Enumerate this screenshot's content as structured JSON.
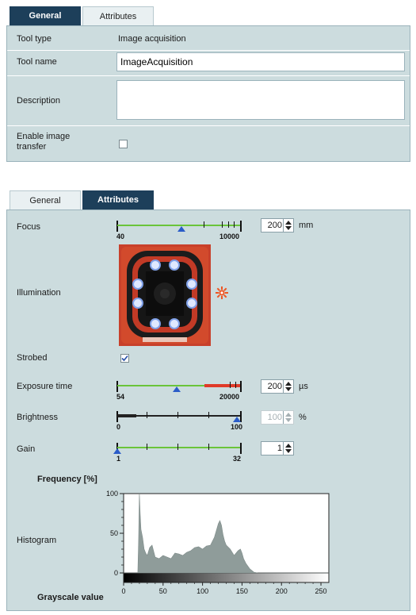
{
  "top_panel": {
    "tabs": [
      {
        "label": "General",
        "active": true
      },
      {
        "label": "Attributes",
        "active": false
      }
    ],
    "tool_type": {
      "label": "Tool type",
      "value": "Image acquisition"
    },
    "tool_name": {
      "label": "Tool name",
      "value": "ImageAcquisition"
    },
    "description": {
      "label": "Description",
      "value": ""
    },
    "enable_transfer": {
      "label": "Enable image transfer",
      "checked": false
    }
  },
  "bottom_panel": {
    "tabs": [
      {
        "label": "General",
        "active": false
      },
      {
        "label": "Attributes",
        "active": true
      }
    ],
    "focus": {
      "label": "Focus",
      "min": "40",
      "max": "10000",
      "value": "200",
      "unit": "mm",
      "position": 0.45
    },
    "illumination": {
      "label": "Illumination",
      "icon": "sun-gear-icon"
    },
    "strobed": {
      "label": "Strobed",
      "checked": true
    },
    "exposure": {
      "label": "Exposure time",
      "min": "54",
      "max": "20000",
      "value": "200",
      "unit": "µs",
      "position": 0.42,
      "red_from": 0.7
    },
    "brightness": {
      "label": "Brightness",
      "min": "0",
      "max": "100",
      "value": "100",
      "unit": "%",
      "position": 1.0
    },
    "gain": {
      "label": "Gain",
      "min": "1",
      "max": "32",
      "value": "1",
      "position": 0.0
    },
    "histogram": {
      "label": "Histogram",
      "ylabel": "Frequency [%]",
      "xlabel": "Grayscale value",
      "y_ticks": [
        "100",
        "50",
        "0"
      ],
      "x_ticks": [
        "0",
        "50",
        "100",
        "150",
        "200",
        "250"
      ]
    }
  },
  "chart_data": {
    "type": "area",
    "title": "",
    "xlabel": "Grayscale value",
    "ylabel": "Frequency [%]",
    "xlim": [
      0,
      260
    ],
    "ylim": [
      0,
      100
    ],
    "x": [
      0,
      18,
      19,
      20,
      21,
      22,
      24,
      26,
      28,
      30,
      33,
      36,
      40,
      45,
      50,
      55,
      60,
      65,
      70,
      75,
      80,
      85,
      90,
      95,
      100,
      105,
      110,
      115,
      118,
      120,
      122,
      124,
      126,
      128,
      130,
      135,
      140,
      145,
      148,
      150,
      152,
      155,
      160,
      165,
      170,
      260
    ],
    "y": [
      0,
      0,
      40,
      100,
      75,
      55,
      45,
      30,
      25,
      22,
      32,
      35,
      20,
      18,
      22,
      20,
      18,
      25,
      24,
      22,
      26,
      28,
      32,
      33,
      30,
      34,
      35,
      45,
      55,
      62,
      66,
      60,
      48,
      40,
      35,
      30,
      22,
      28,
      30,
      25,
      18,
      12,
      5,
      1,
      0,
      0
    ]
  }
}
